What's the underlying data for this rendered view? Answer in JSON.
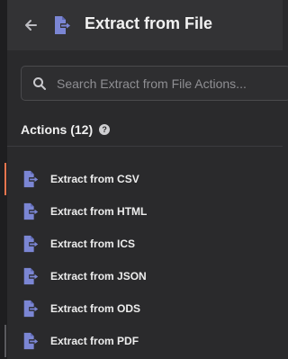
{
  "header": {
    "title": "Extract from File",
    "back_icon": "arrow-left-icon",
    "app_icon": "file-export-icon"
  },
  "search": {
    "placeholder": "Search Extract from File Actions...",
    "value": "",
    "icon": "search-icon"
  },
  "actions": {
    "heading": "Actions (12)",
    "help_icon": "question-circle-icon",
    "help_glyph": "?",
    "items": [
      {
        "label": "Extract from CSV",
        "icon": "file-export-icon"
      },
      {
        "label": "Extract from HTML",
        "icon": "file-export-icon"
      },
      {
        "label": "Extract from ICS",
        "icon": "file-export-icon"
      },
      {
        "label": "Extract from JSON",
        "icon": "file-export-icon"
      },
      {
        "label": "Extract from ODS",
        "icon": "file-export-icon"
      },
      {
        "label": "Extract from PDF",
        "icon": "file-export-icon"
      }
    ]
  },
  "colors": {
    "background": "#2a2a2c",
    "header_background": "#333335",
    "icon_accent": "#7b86d4",
    "active_marker": "#e8754e"
  }
}
